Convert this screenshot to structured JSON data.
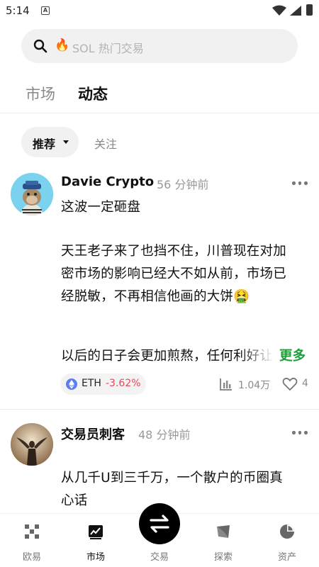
{
  "status": {
    "time": "5:14",
    "notif_letter": "A"
  },
  "search": {
    "placeholder": "SOL 热门交易",
    "fire": "🔥"
  },
  "top_tabs": [
    {
      "label": "市场",
      "active": false
    },
    {
      "label": "动态",
      "active": true
    }
  ],
  "sub_tabs": {
    "recommend": "推荐",
    "follow": "关注"
  },
  "posts": [
    {
      "author": "Davie Crypto",
      "time": "56 分钟前",
      "lines": [
        "这波一定砸盘",
        "",
        "天王老子来了也挡不住，川普现在对加",
        "密市场的影响已经大不如从前，市场已",
        "经脱敏，不再相信他画的大饼🤮",
        "",
        "",
        "以后的日子会更加煎熬，任何利好让"
      ],
      "more": "更多",
      "coin": {
        "symbol": "ETH",
        "change": "-3.62%",
        "change_color": "#e8445a"
      },
      "views": "1.04万",
      "likes": "4"
    },
    {
      "author": "交易员刺客",
      "time": "48 分钟前",
      "lines": [
        "从几千U到三千万，一个散户的币圈真",
        "心话"
      ]
    }
  ],
  "nav": [
    {
      "label": "欧易",
      "icon": "okx-logo-icon",
      "active": false
    },
    {
      "label": "市场",
      "icon": "chart-icon",
      "active": true
    },
    {
      "label": "交易",
      "icon": "swap-icon",
      "active": false
    },
    {
      "label": "探索",
      "icon": "compass-icon",
      "active": false
    },
    {
      "label": "资产",
      "icon": "pie-icon",
      "active": false
    }
  ],
  "colors": {
    "accent_green": "#1aa039",
    "negative_red": "#e8445a",
    "eth_blue": "#5c7ef2"
  }
}
